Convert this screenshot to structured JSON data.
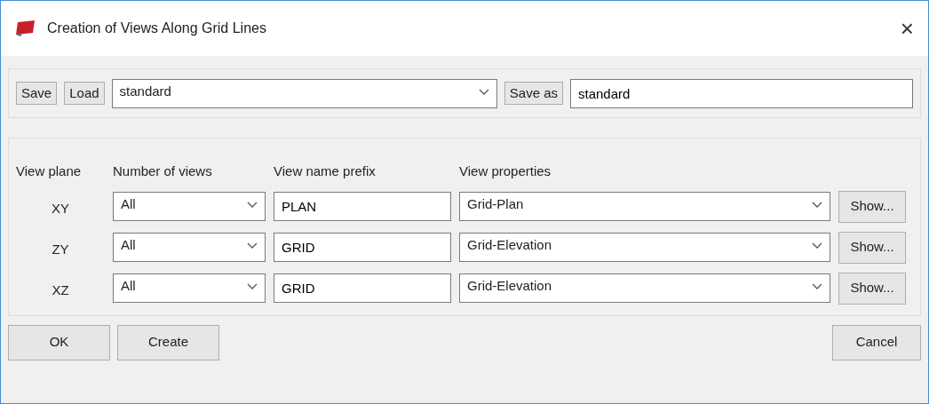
{
  "window": {
    "title": "Creation of Views Along Grid Lines",
    "close": "×"
  },
  "settings_bar": {
    "save": "Save",
    "load": "Load",
    "preset": "standard",
    "save_as": "Save as",
    "save_as_name": "standard"
  },
  "table": {
    "columns": [
      "View plane",
      "Number of views",
      "View name prefix",
      "View properties"
    ],
    "rows": [
      {
        "plane": "XY",
        "number": "All",
        "prefix": "PLAN",
        "properties": "Grid-Plan",
        "show": "Show..."
      },
      {
        "plane": "ZY",
        "number": "All",
        "prefix": "GRID",
        "properties": "Grid-Elevation",
        "show": "Show..."
      },
      {
        "plane": "XZ",
        "number": "All",
        "prefix": "GRID",
        "properties": "Grid-Elevation",
        "show": "Show..."
      }
    ]
  },
  "buttons": {
    "ok": "OK",
    "create": "Create",
    "cancel": "Cancel"
  }
}
